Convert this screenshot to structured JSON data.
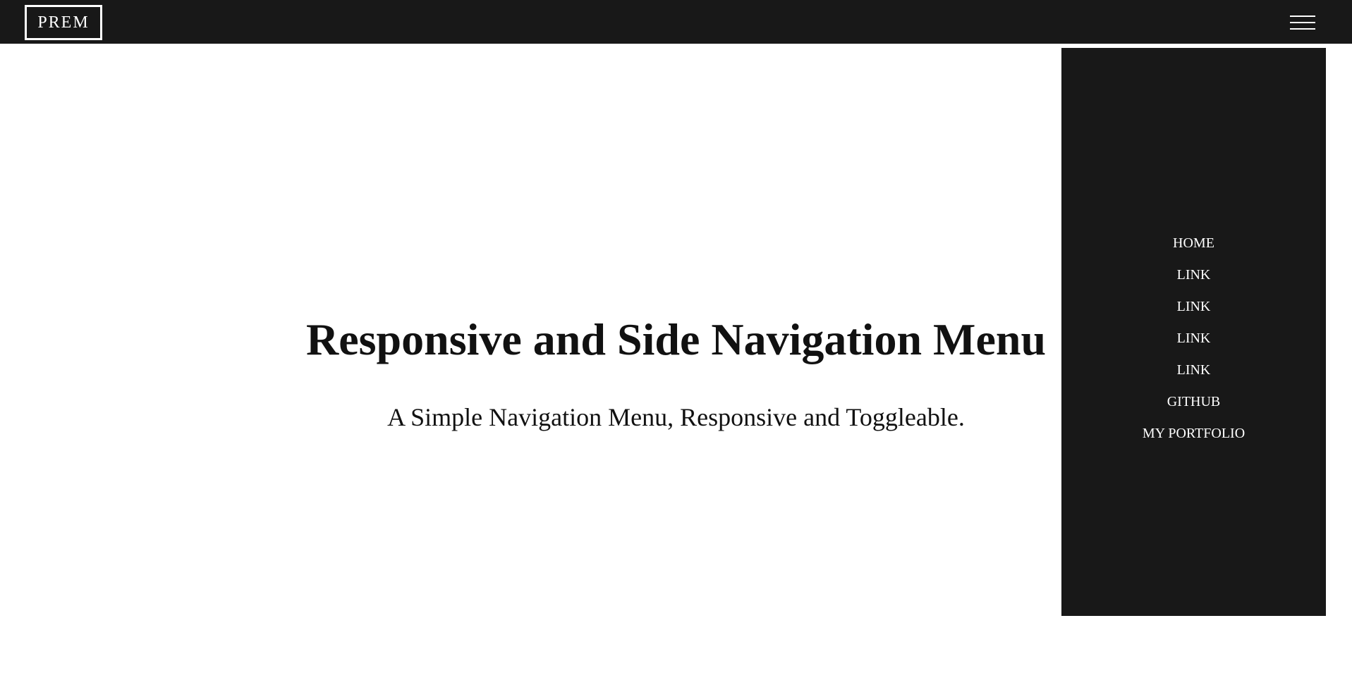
{
  "header": {
    "logo_text": "PREM",
    "menu_icon": "hamburger-menu-icon"
  },
  "hero": {
    "title": "Responsive and Side Navigation Menu",
    "subtitle": "A Simple Navigation Menu, Responsive and Toggleable."
  },
  "sidenav": {
    "items": [
      {
        "label": "HOME"
      },
      {
        "label": "LINK"
      },
      {
        "label": "LINK"
      },
      {
        "label": "LINK"
      },
      {
        "label": "LINK"
      },
      {
        "label": "GITHUB"
      },
      {
        "label": "MY PORTFOLIO"
      }
    ]
  },
  "colors": {
    "bar_background": "#181818",
    "page_background": "#ffffff",
    "text_light": "#ffffff",
    "text_dark": "#111111"
  }
}
